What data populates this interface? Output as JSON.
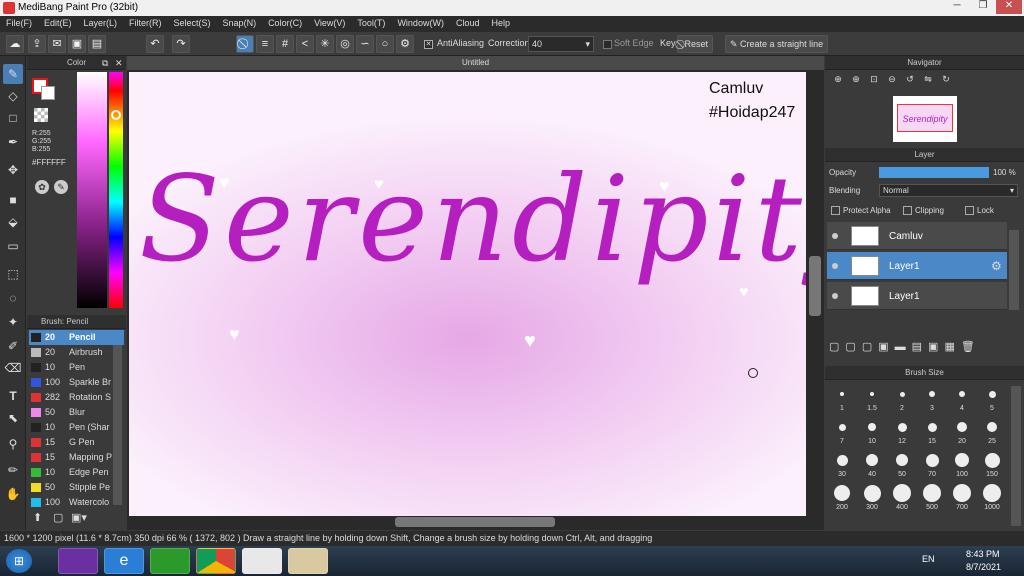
{
  "window": {
    "title": "MediBang Paint Pro (32bit)"
  },
  "menu": [
    "File(F)",
    "Edit(E)",
    "Layer(L)",
    "Filter(R)",
    "Select(S)",
    "Snap(N)",
    "Color(C)",
    "View(V)",
    "Tool(T)",
    "Window(W)",
    "Cloud",
    "Help"
  ],
  "toolbar": {
    "antialiasing_label": "AntiAliasing",
    "correction_label": "Correction",
    "correction_value": "40",
    "soft_edge_label": "Soft Edge",
    "key_label": "Key",
    "reset_label": "Reset",
    "straight_line_label": "Create a straight line"
  },
  "color_panel": {
    "title": "Color",
    "r": "R:255",
    "g": "G:255",
    "b": "B:255",
    "hex": "#FFFFFF"
  },
  "brush_panel": {
    "title": "Brush: Pencil",
    "items": [
      {
        "size": "20",
        "name": "Pencil",
        "color": "#222222"
      },
      {
        "size": "20",
        "name": "Airbrush",
        "color": "#bbbbbb"
      },
      {
        "size": "10",
        "name": "Pen",
        "color": "#222222"
      },
      {
        "size": "100",
        "name": "Sparkle Br",
        "color": "#3355dd"
      },
      {
        "size": "282",
        "name": "Rotation S",
        "color": "#dd3333"
      },
      {
        "size": "50",
        "name": "Blur",
        "color": "#ee88ee"
      },
      {
        "size": "10",
        "name": "Pen (Shar",
        "color": "#222222"
      },
      {
        "size": "15",
        "name": "G Pen",
        "color": "#dd3333"
      },
      {
        "size": "15",
        "name": "Mapping P",
        "color": "#dd3333"
      },
      {
        "size": "10",
        "name": "Edge Pen",
        "color": "#33bb33"
      },
      {
        "size": "50",
        "name": "Stipple Pe",
        "color": "#eedd22"
      },
      {
        "size": "100",
        "name": "Watercolo",
        "color": "#22bbee"
      }
    ]
  },
  "canvas": {
    "tab_title": "Untitled",
    "art_text": "Serendipity",
    "watermark_line1": "Camluv",
    "watermark_line2": "#Hoidap247"
  },
  "navigator": {
    "title": "Navigator",
    "thumb_text": "Serendipity"
  },
  "layer_panel": {
    "title": "Layer",
    "opacity_label": "Opacity",
    "opacity_value": "100 %",
    "opacity_fraction": 1.0,
    "blending_label": "Blending",
    "blending_value": "Normal",
    "protect_alpha": "Protect Alpha",
    "clipping": "Clipping",
    "lock": "Lock",
    "layers": [
      {
        "name": "Camluv",
        "selected": false
      },
      {
        "name": "Layer1",
        "selected": true
      },
      {
        "name": "Layer1",
        "selected": false
      }
    ]
  },
  "brush_size_panel": {
    "title": "Brush Size",
    "sizes": [
      "1",
      "1.5",
      "2",
      "3",
      "4",
      "5",
      "7",
      "10",
      "12",
      "15",
      "20",
      "25",
      "30",
      "40",
      "50",
      "70",
      "100",
      "150",
      "200",
      "300",
      "400",
      "500",
      "700",
      "1000"
    ]
  },
  "status": "1600 * 1200 pixel   (11.6 * 8.7cm)   350 dpi   66 %   ( 1372, 802 )   Draw a straight line by holding down Shift, Change a brush size by holding down Ctrl, Alt, and dragging",
  "taskbar": {
    "lang": "EN",
    "time": "8:43 PM",
    "date": "8/7/2021"
  },
  "colors": {
    "accent": "#4a88c7",
    "ink": "#b51fc0"
  }
}
